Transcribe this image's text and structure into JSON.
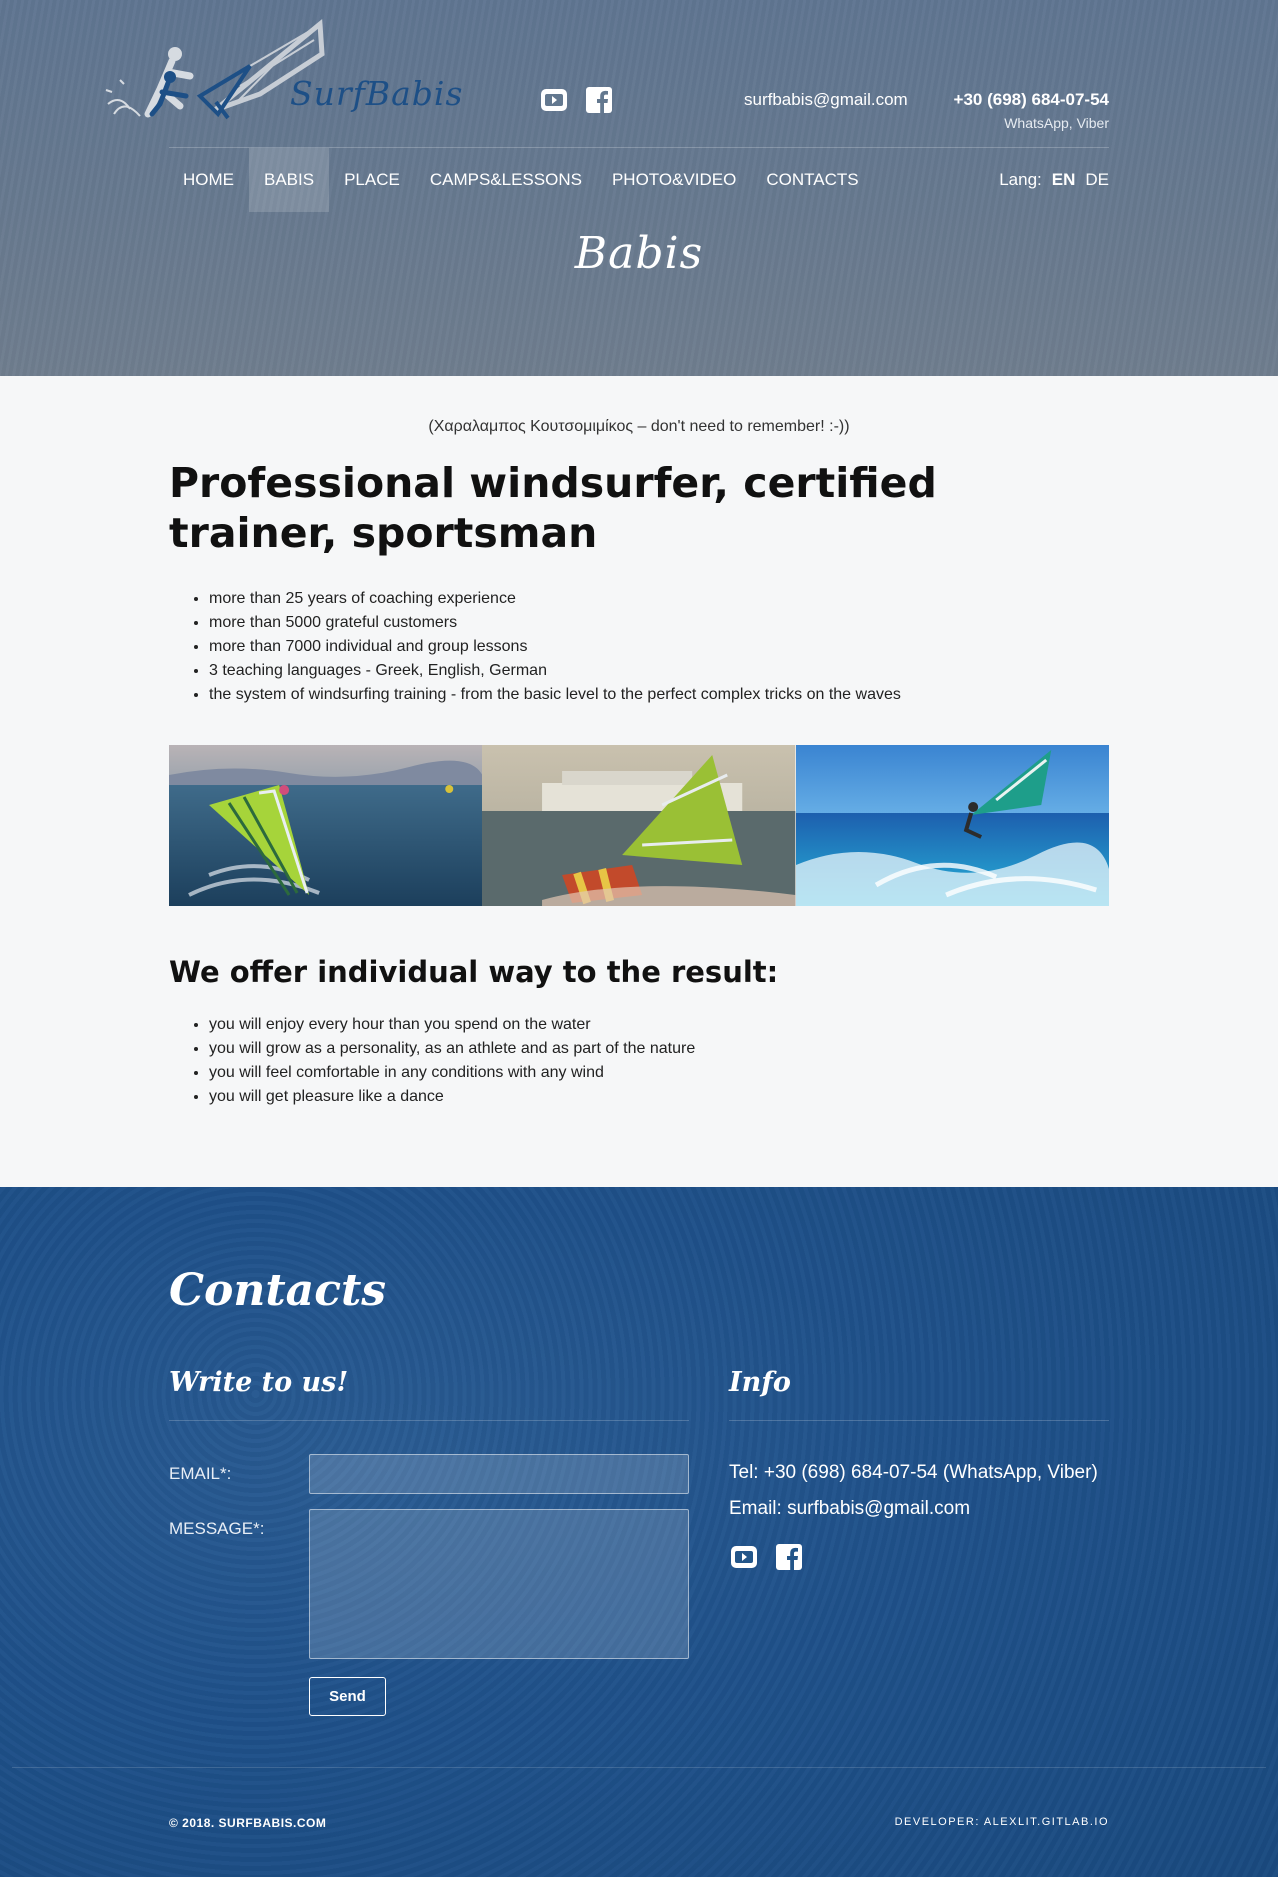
{
  "header": {
    "logo_text": "SurfBabis",
    "email": "surfbabis@gmail.com",
    "phone": "+30 (698) 684-07-54",
    "phone_note": "WhatsApp, Viber",
    "icons": [
      "youtube-icon",
      "facebook-icon"
    ]
  },
  "nav": {
    "items": [
      {
        "label": "HOME",
        "active": false
      },
      {
        "label": "BABIS",
        "active": true
      },
      {
        "label": "PLACE",
        "active": false
      },
      {
        "label": "CAMPS&LESSONS",
        "active": false
      },
      {
        "label": "PHOTO&VIDEO",
        "active": false
      },
      {
        "label": "CONTACTS",
        "active": false
      }
    ],
    "lang_label": "Lang:",
    "lang_options": [
      "EN",
      "DE"
    ],
    "lang_selected": "EN"
  },
  "hero": {
    "title": "Babis"
  },
  "main": {
    "greek_name": "(Χαραλαμπος Κουτσομιμίκος – don't need to remember! :-))",
    "headline": "Professional windsurfer, certified trainer, sportsman",
    "facts": [
      "more than 25 years of coaching experience",
      "more than 5000 grateful customers",
      "more than 7000 individual and group lessons",
      "3 teaching languages - Greek, English, German",
      "the system of windsurfing training - from the basic level to the perfect complex tricks on the waves"
    ],
    "offer_title": "We offer individual way to the result:",
    "offers": [
      "you will enjoy every hour than you spend on the water",
      "you will grow as a personality, as an athlete and as part of the nature",
      "you will feel comfortable in any conditions with any wind",
      "you will get pleasure like a dance"
    ]
  },
  "footer": {
    "title": "Contacts",
    "write_title": "Write to us!",
    "info_title": "Info",
    "email_label": "EMAIL*:",
    "message_label": "MESSAGE*:",
    "email_value": "",
    "message_value": "",
    "send_label": "Send",
    "tel_line": "Tel: +30 (698) 684-07-54 (WhatsApp, Viber)",
    "email_line": "Email: surfbabis@gmail.com",
    "copyright": "© 2018. SURFBABIS.COM",
    "developer": "DEVELOPER: ALEXLIT.GITLAB.IO"
  }
}
